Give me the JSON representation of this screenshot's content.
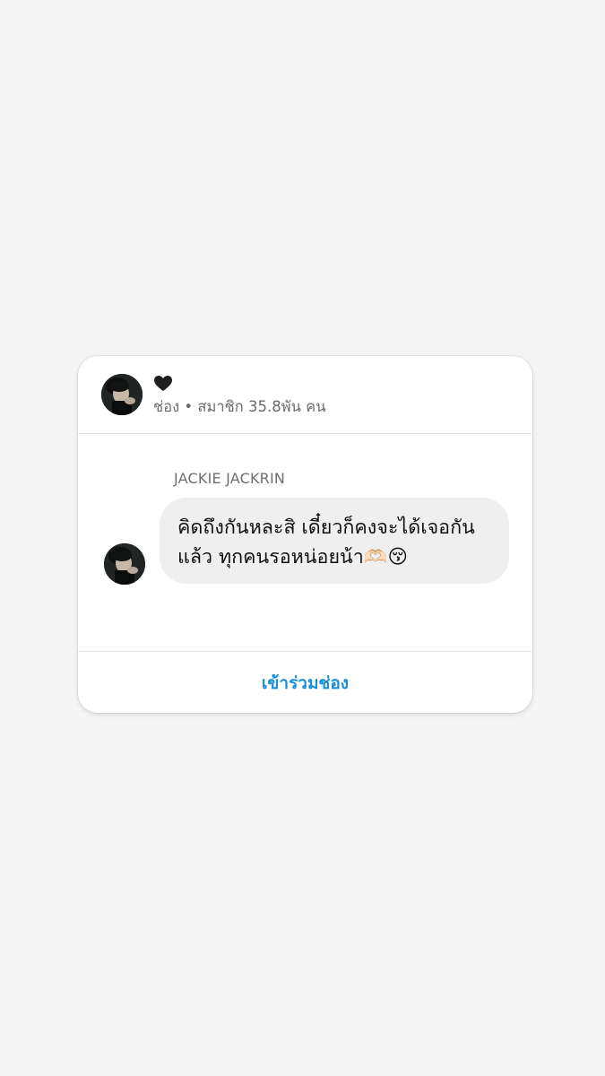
{
  "channel": {
    "name_emoji": "🖤",
    "meta": "ช่อง • สมาชิก 35.8พัน คน",
    "avatar": "profile-photo"
  },
  "message": {
    "sender": "JACKIE JACKRIN",
    "lines": [
      "คิดถึงกันหละสิ เดี๋ยวก็คงจะได้เจอกัน",
      "แล้ว ทุกคนรอหน่อยน้า🫶🏻😚"
    ],
    "avatar": "profile-photo"
  },
  "footer": {
    "join_label": "เข้าร่วมช่อง"
  },
  "colors": {
    "background": "#f5f5f5",
    "card": "#ffffff",
    "bubble": "#efefef",
    "accent": "#1a8fd8",
    "muted_text": "#6b6b6b"
  }
}
